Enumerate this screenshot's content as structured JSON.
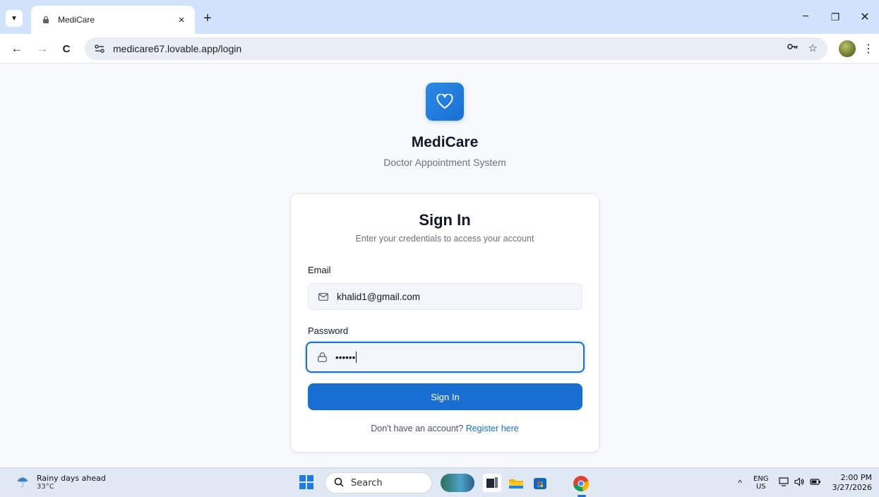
{
  "browser": {
    "tab_title": "MediCare",
    "url": "medicare67.lovable.app/login",
    "new_tab_glyph": "+",
    "tab_close_glyph": "×",
    "minimize_glyph": "−",
    "restore_glyph": "❐",
    "close_glyph": "✕",
    "back_glyph": "←",
    "forward_glyph": "→",
    "reload_glyph": "C",
    "menu_glyph": "⋮"
  },
  "brand": {
    "name": "MediCare",
    "tagline": "Doctor Appointment System",
    "accent": "#1a6fd3"
  },
  "signin": {
    "title": "Sign In",
    "subtitle": "Enter your credentials to access your account",
    "email_label": "Email",
    "email_value": "khalid1@gmail.com",
    "password_label": "Password",
    "password_value": "••••••",
    "button_label": "Sign In",
    "register_prompt": "Don't have an account?",
    "register_link": "Register here"
  },
  "taskbar": {
    "weather_desc": "Rainy days ahead",
    "weather_temp": "33°C",
    "search_label": "Search",
    "lang_top": "ENG",
    "lang_bottom": "US",
    "time": "2:00 PM",
    "date": "3/27/2026"
  }
}
